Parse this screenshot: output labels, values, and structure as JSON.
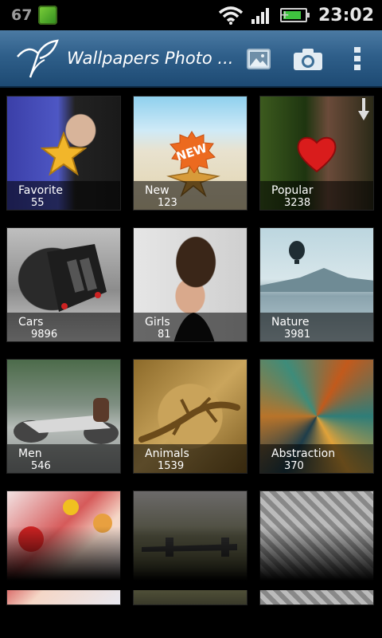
{
  "status_bar": {
    "left_number": "67",
    "app_icon": "tiger-app-icon",
    "wifi_icon": "wifi-icon",
    "signal_icon": "signal-icon",
    "battery_icon": "battery-charging-icon",
    "battery_level": 0.85,
    "time": "23:02"
  },
  "action_bar": {
    "logo_icon": "app-logo-icon",
    "title": "Wallpapers Photo ...",
    "gallery_icon": "gallery-icon",
    "camera_icon": "camera-icon",
    "overflow_icon": "overflow-menu-icon",
    "accent_color": "#2f5f8a"
  },
  "categories": [
    {
      "label": "Favorite",
      "count": "55"
    },
    {
      "label": "New",
      "count": "123"
    },
    {
      "label": "Popular",
      "count": "3238"
    },
    {
      "label": "Cars",
      "count": "9896"
    },
    {
      "label": "Girls",
      "count": "81"
    },
    {
      "label": "Nature",
      "count": "3981"
    },
    {
      "label": "Men",
      "count": "546"
    },
    {
      "label": "Animals",
      "count": "1539"
    },
    {
      "label": "Abstraction",
      "count": "370"
    },
    {
      "label": "",
      "count": ""
    },
    {
      "label": "",
      "count": ""
    },
    {
      "label": "",
      "count": ""
    }
  ],
  "badges": {
    "new_badge": "NEW"
  }
}
